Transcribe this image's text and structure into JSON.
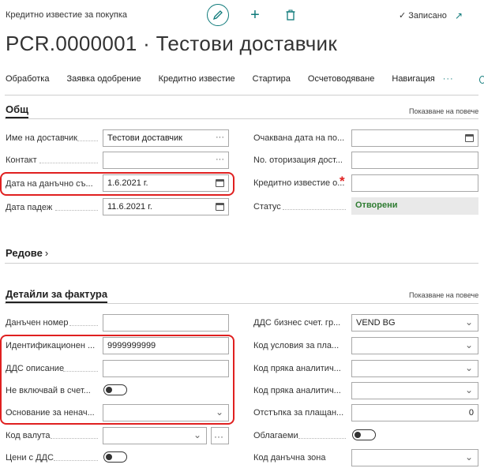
{
  "header": {
    "caption": "Кредитно известие за покупка",
    "saved_label": "Записано",
    "title": "PCR.0000001 · Тестови доставчик"
  },
  "actions": [
    "Обработка",
    "Заявка одобрение",
    "Кредитно известие",
    "Стартира",
    "Осчетоводяване",
    "Навигация"
  ],
  "general": {
    "section_title": "Общ",
    "show_more": "Показване на повече",
    "vendor_name_label": "Име на доставчик",
    "vendor_name_value": "Тестови доставчик",
    "contact_label": "Контакт",
    "doc_date_label": "Дата на данъчно съ...",
    "doc_date_value": "1.6.2021 г.",
    "due_date_label": "Дата падеж",
    "due_date_value": "11.6.2021 г.",
    "expected_date_label": "Очаквана дата на по...",
    "auth_no_label": "No. оторизация дост...",
    "credit_memo_label": "Кредитно известие о...",
    "status_label": "Статус",
    "status_value": "Отворени"
  },
  "lines": {
    "section_title": "Редове"
  },
  "invoice_details": {
    "section_title": "Детайли за фактура",
    "show_more": "Показване на повече",
    "tax_no_label": "Данъчен номер",
    "ident_label": "Идентификационен ...",
    "ident_value": "9999999999",
    "vat_desc_label": "ДДС описание",
    "exclude_label": "Не включвай в счет...",
    "reason_label": "Основание за ненач...",
    "currency_label": "Код валута",
    "prices_vat_label": "Цени с ДДС",
    "vat_bus_label": "ДДС бизнес счет. гр...",
    "vat_bus_value": "VEND BG",
    "payment_terms_label": "Код условия за пла...",
    "dim1_label": "Код пряка аналитич...",
    "dim2_label": "Код пряка аналитич...",
    "discount_label": "Отстъпка за плащан...",
    "discount_value": "0",
    "taxable_label": "Облагаеми",
    "tax_area_label": "Код данъчна зона"
  }
}
